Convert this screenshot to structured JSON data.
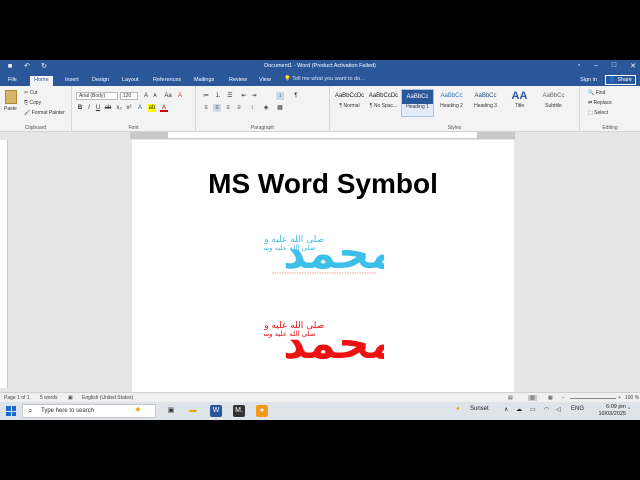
{
  "title_bar": {
    "title": "Document1 - Word (Product Activation Failed)",
    "quick_access": [
      "save-icon",
      "undo-icon",
      "redo-icon"
    ]
  },
  "tabs": [
    "File",
    "Home",
    "Insert",
    "Design",
    "Layout",
    "References",
    "Mailings",
    "Review",
    "View"
  ],
  "active_tab": "Home",
  "tell_me": "Tell me what you want to do...",
  "signin": "Sign in",
  "share": "Share",
  "ribbon": {
    "clipboard": {
      "paste": "Paste",
      "cut": "Cut",
      "copy": "Copy",
      "format_painter": "Format Painter",
      "label": "Clipboard"
    },
    "font": {
      "font_name": "Arial (Body)",
      "font_size": "120",
      "label": "Font"
    },
    "paragraph": {
      "label": "Paragraph"
    },
    "styles": {
      "label": "Styles",
      "items": [
        {
          "preview": "AaBbCcDc",
          "name": "¶ Normal"
        },
        {
          "preview": "AaBbCcDc",
          "name": "¶ No Spac..."
        },
        {
          "preview": "AaBbCc",
          "name": "Heading 1"
        },
        {
          "preview": "AaBbCc",
          "name": "Heading 2"
        },
        {
          "preview": "AaBbCc",
          "name": "Heading 3"
        },
        {
          "preview": "AA",
          "name": "Title"
        },
        {
          "preview": "AaBbCc",
          "name": "Subtitle"
        }
      ]
    },
    "editing": {
      "find": "Find",
      "replace": "Replace",
      "select": "Select",
      "label": "Editing"
    }
  },
  "document": {
    "heading": "MS Word Symbol",
    "symbol_text": "محمد",
    "blessing_text": "صلى الله عليه وسلم",
    "colors": {
      "symbol1": "#3cc0ea",
      "symbol2": "#ee1111"
    }
  },
  "status": {
    "page": "Page 1 of 1",
    "words": "5 words",
    "language": "English (United States)",
    "zoom": "100 %"
  },
  "taskbar": {
    "search_placeholder": "Type here to search",
    "weather": "Sunset",
    "language": "ENG",
    "time": "6:09 pm",
    "date": "10/03/2025"
  }
}
